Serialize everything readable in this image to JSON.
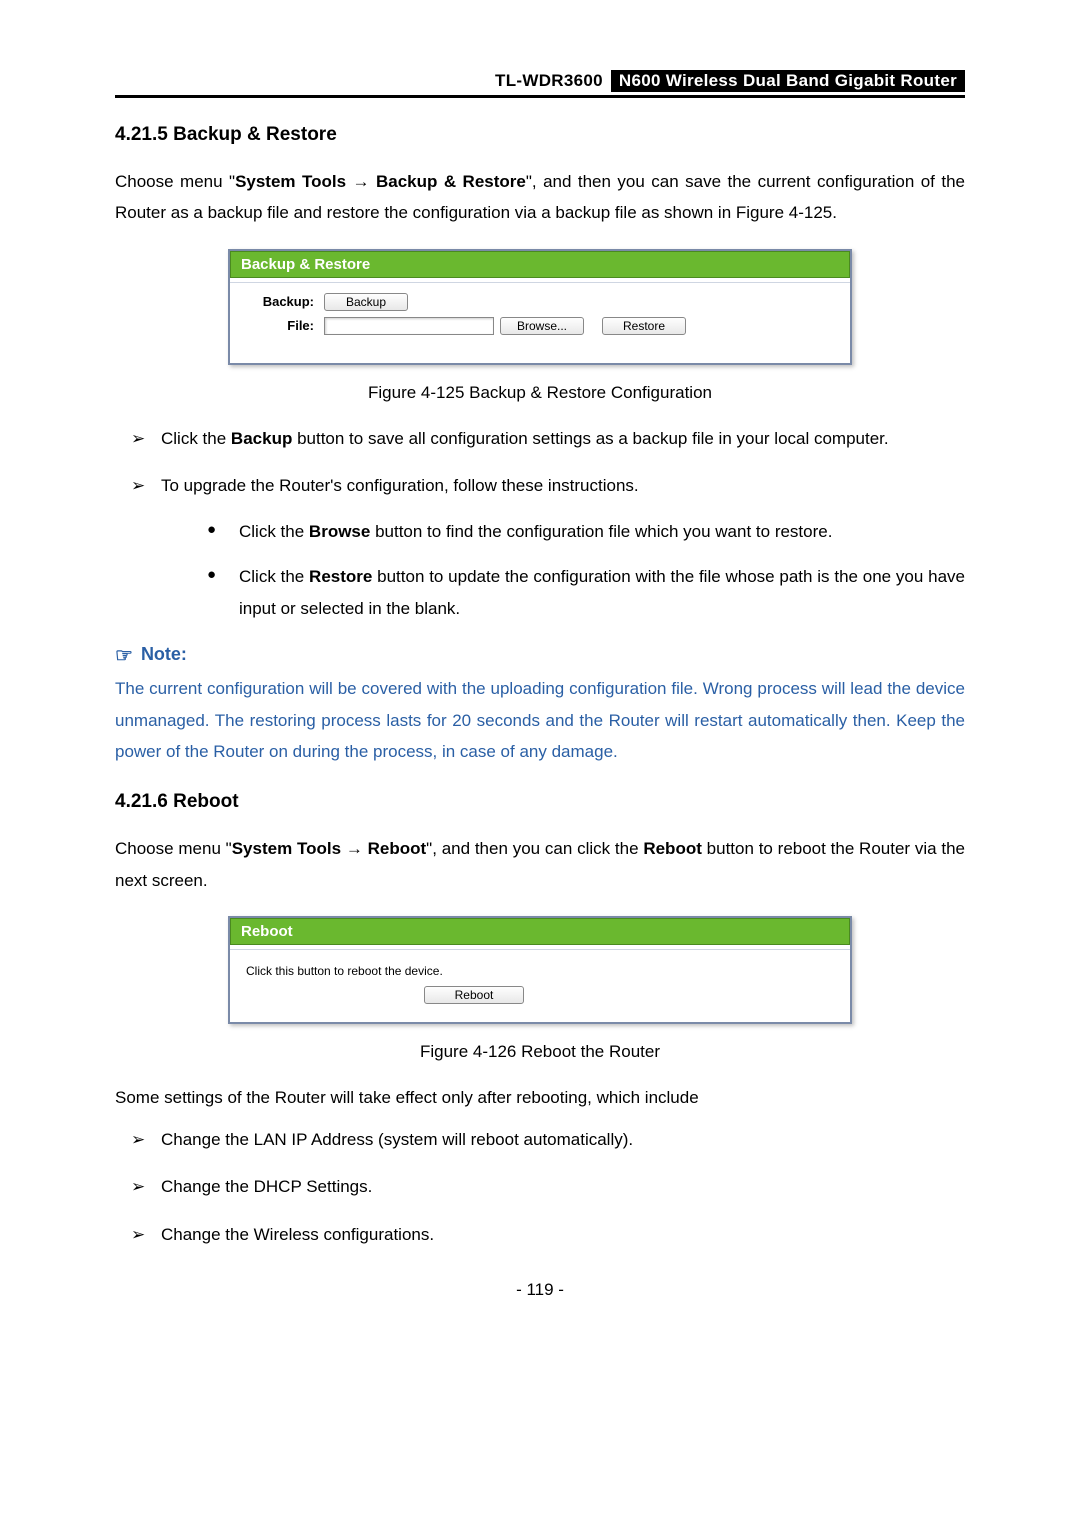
{
  "header": {
    "model": "TL-WDR3600",
    "product": "N600 Wireless Dual Band Gigabit Router"
  },
  "section1": {
    "heading": "4.21.5  Backup & Restore",
    "intro_part1": "Choose menu \"",
    "intro_bold": "System Tools → Backup & Restore",
    "intro_part2": "\", and then you can save the current configuration of the Router as a backup file and restore the configuration via a backup file as shown in Figure 4-125."
  },
  "panel1": {
    "title": "Backup & Restore",
    "backup_label": "Backup:",
    "file_label": "File:",
    "backup_btn": "Backup",
    "browse_btn": "Browse...",
    "restore_btn": "Restore",
    "caption": "Figure 4-125 Backup & Restore Configuration"
  },
  "list1": {
    "item1_a": "Click the ",
    "item1_bold": "Backup",
    "item1_b": " button to save all configuration settings as a backup file in your local computer.",
    "item2": "To upgrade the Router's configuration, follow these instructions.",
    "sub1_a": "Click the ",
    "sub1_bold": "Browse",
    "sub1_b": " button to find the configuration file which you want to restore.",
    "sub2_a": "Click the ",
    "sub2_bold": "Restore",
    "sub2_b": " button to update the configuration with the file whose path is the one you have input or selected in the blank."
  },
  "note": {
    "label": "Note:",
    "body": "The current configuration will be covered with the uploading configuration file. Wrong process will lead the device unmanaged. The restoring process lasts for 20 seconds and the Router will restart automatically then. Keep the power of the Router on during the process, in case of any damage."
  },
  "section2": {
    "heading": "4.21.6  Reboot",
    "intro_a": "Choose menu \"",
    "intro_bold": "System Tools → Reboot",
    "intro_b": "\", and then you can click the ",
    "intro_bold2": "Reboot",
    "intro_c": " button to reboot the Router via the next screen."
  },
  "panel2": {
    "title": "Reboot",
    "hint": "Click this button to reboot the device.",
    "reboot_btn": "Reboot",
    "caption": "Figure 4-126 Reboot the Router"
  },
  "list2": {
    "intro": "Some settings of the Router will take effect only after rebooting, which include",
    "item1": "Change the LAN IP Address (system will reboot automatically).",
    "item2": "Change the DHCP Settings.",
    "item3": "Change the Wireless configurations."
  },
  "pagenum": "- 119 -"
}
